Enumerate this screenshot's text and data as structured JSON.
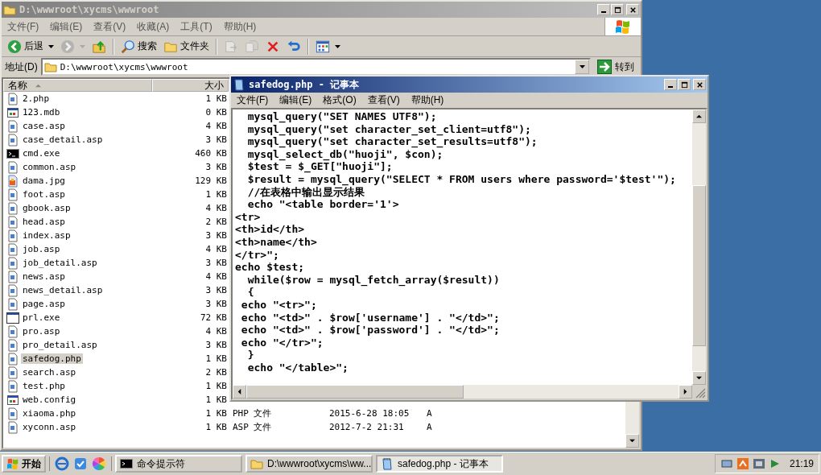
{
  "explorer": {
    "title": "D:\\wwwroot\\xycms\\wwwroot",
    "active": false,
    "menu": [
      "文件(F)",
      "编辑(E)",
      "查看(V)",
      "收藏(A)",
      "工具(T)",
      "帮助(H)"
    ],
    "toolbar": [
      {
        "kind": "back",
        "label": "后退",
        "disabled": false
      },
      {
        "kind": "forward",
        "disabled": true
      },
      {
        "kind": "up",
        "disabled": false
      },
      {
        "kind": "search",
        "label": "搜索",
        "disabled": false
      },
      {
        "kind": "folders",
        "label": "文件夹",
        "disabled": false
      },
      {
        "kind": "move",
        "disabled": true
      },
      {
        "kind": "copy",
        "disabled": true
      },
      {
        "kind": "delete",
        "disabled": false
      },
      {
        "kind": "undo",
        "disabled": false
      },
      {
        "kind": "views",
        "disabled": false
      }
    ],
    "address": {
      "label": "地址(D)",
      "value": "D:\\wwwroot\\xycms\\wwwroot",
      "go": "转到"
    },
    "columns": [
      "名称",
      "大小"
    ],
    "files": [
      {
        "name": "2.php",
        "size": "1 KB",
        "kind": "script",
        "selected": false
      },
      {
        "name": "123.mdb",
        "size": "0 KB",
        "kind": "config",
        "selected": false
      },
      {
        "name": "case.asp",
        "size": "4 KB",
        "kind": "script",
        "selected": false
      },
      {
        "name": "case_detail.asp",
        "size": "3 KB",
        "kind": "script",
        "selected": false
      },
      {
        "name": "cmd.exe",
        "size": "460 KB",
        "kind": "console",
        "selected": false
      },
      {
        "name": "common.asp",
        "size": "3 KB",
        "kind": "script",
        "selected": false
      },
      {
        "name": "dama.jpg",
        "size": "129 KB",
        "kind": "image",
        "selected": false
      },
      {
        "name": "foot.asp",
        "size": "1 KB",
        "kind": "script",
        "selected": false
      },
      {
        "name": "gbook.asp",
        "size": "4 KB",
        "kind": "script",
        "selected": false
      },
      {
        "name": "head.asp",
        "size": "2 KB",
        "kind": "script",
        "selected": false
      },
      {
        "name": "index.asp",
        "size": "3 KB",
        "kind": "script",
        "selected": false
      },
      {
        "name": "job.asp",
        "size": "4 KB",
        "kind": "script",
        "selected": false
      },
      {
        "name": "job_detail.asp",
        "size": "3 KB",
        "kind": "script",
        "selected": false
      },
      {
        "name": "news.asp",
        "size": "4 KB",
        "kind": "script",
        "selected": false
      },
      {
        "name": "news_detail.asp",
        "size": "3 KB",
        "kind": "script",
        "selected": false
      },
      {
        "name": "page.asp",
        "size": "3 KB",
        "kind": "script",
        "selected": false
      },
      {
        "name": "prl.exe",
        "size": "72 KB",
        "kind": "program",
        "selected": false
      },
      {
        "name": "pro.asp",
        "size": "4 KB",
        "kind": "script",
        "selected": false
      },
      {
        "name": "pro_detail.asp",
        "size": "3 KB",
        "kind": "script",
        "selected": false
      },
      {
        "name": "safedog.php",
        "size": "1 KB",
        "kind": "script",
        "selected": true
      },
      {
        "name": "search.asp",
        "size": "2 KB",
        "kind": "script",
        "selected": false
      },
      {
        "name": "test.php",
        "size": "1 KB",
        "kind": "script",
        "selected": false
      },
      {
        "name": "web.config",
        "size": "1 KB",
        "kind": "config",
        "selected": false
      },
      {
        "name": "xiaoma.php",
        "size": "1 KB",
        "kind": "script",
        "selected": false,
        "type": "PHP 文件",
        "date": "2015-6-28 18:05",
        "attr": "A"
      },
      {
        "name": "xyconn.asp",
        "size": "1 KB",
        "kind": "script",
        "selected": false,
        "type": "ASP 文件",
        "date": "2012-7-2 21:31",
        "attr": "A"
      }
    ]
  },
  "notepad": {
    "title": "safedog.php - 记事本",
    "active": true,
    "menu": [
      "文件(F)",
      "编辑(E)",
      "格式(O)",
      "查看(V)",
      "帮助(H)"
    ],
    "lines": [
      "  mysql_query(\"SET NAMES UTF8\");",
      "  mysql_query(\"set character_set_client=utf8\");",
      "  mysql_query(\"set character_set_results=utf8\");",
      "  mysql_select_db(\"huoji\", $con);",
      "  $test = $_GET[\"huoji\"];",
      "  $result = mysql_query(\"SELECT * FROM users where password='$test'\");",
      "  //在表格中输出显示结果",
      "  echo \"<table border='1'>",
      "<tr>",
      "<th>id</th>",
      "<th>name</th>",
      "</tr>\";",
      "echo $test;",
      "  while($row = mysql_fetch_array($result))",
      "  {",
      " echo \"<tr>\";",
      " echo \"<td>\" . $row['username'] . \"</td>\";",
      " echo \"<td>\" . $row['password'] . \"</td>\";",
      " echo \"</tr>\";",
      "  }",
      "  echo \"</table>\";"
    ]
  },
  "taskbar": {
    "start": "开始",
    "tasks": [
      {
        "label": "命令提示符",
        "kind": "console",
        "selected": false
      },
      {
        "label": "D:\\wwwroot\\xycms\\ww...",
        "kind": "folder",
        "selected": false
      },
      {
        "label": "safedog.php - 记事本",
        "kind": "notepad",
        "selected": true
      }
    ],
    "clock": "21:19"
  }
}
